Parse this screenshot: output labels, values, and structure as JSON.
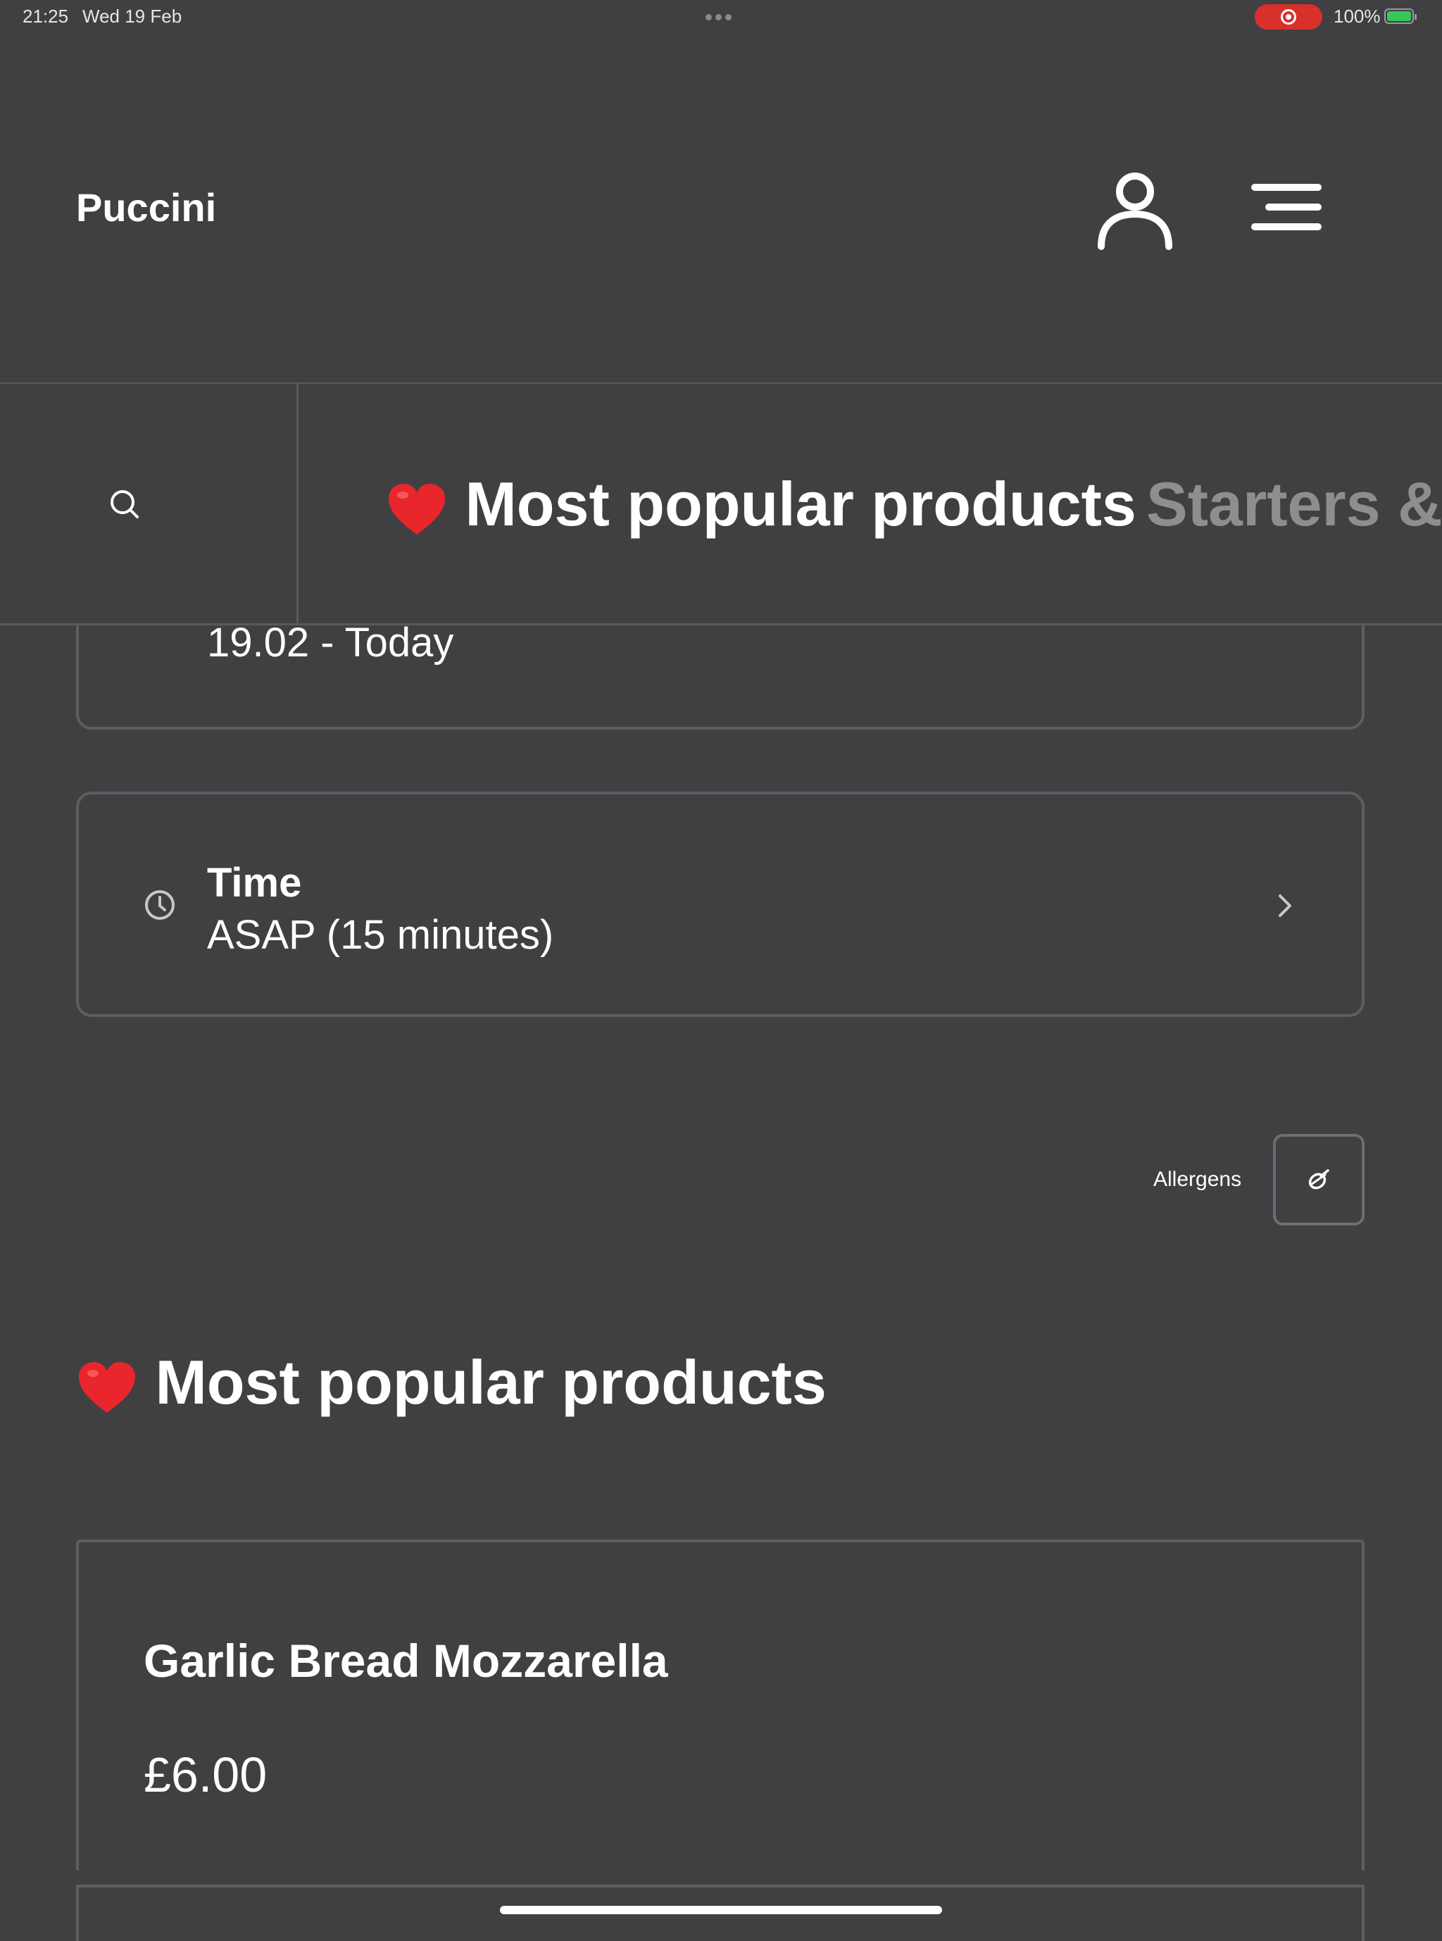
{
  "status_bar": {
    "time": "21:25",
    "date": "Wed 19 Feb",
    "battery": "100%",
    "recording_color": "#d9302b",
    "battery_color": "#34c759"
  },
  "header": {
    "brand": "Puccini",
    "account_icon": "person-icon",
    "menu_icon": "hamburger-menu-icon"
  },
  "category_nav": {
    "search_icon": "search-icon",
    "tabs": [
      {
        "emoji": "heart-icon",
        "label": "Most popular products",
        "active": true
      },
      {
        "label": "Starters &",
        "active": false
      }
    ]
  },
  "order_options": {
    "date_value": "19.02 - Today",
    "time_title": "Time",
    "time_value": "ASAP (15 minutes)"
  },
  "allergens": {
    "label": "Allergens",
    "icon": "allergen-filter-icon"
  },
  "section": {
    "title": "Most popular products"
  },
  "products": [
    {
      "name": "Garlic Bread Mozzarella",
      "price": "£6.00"
    }
  ],
  "colors": {
    "background": "#404042",
    "border": "#5e5e61",
    "inactive_tab": "#8e8e90",
    "heart": "#e8262b"
  }
}
